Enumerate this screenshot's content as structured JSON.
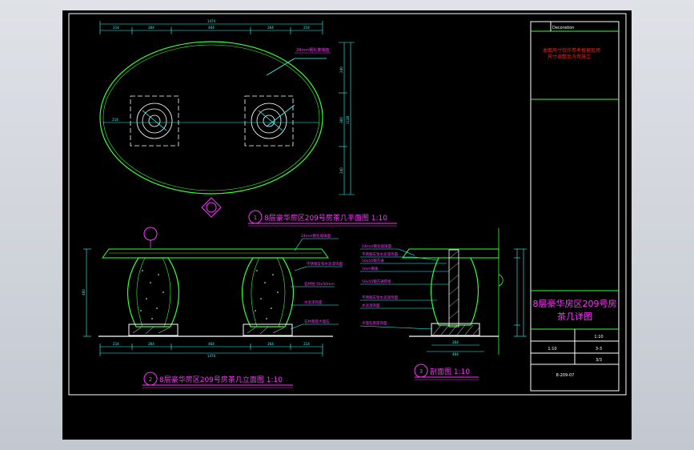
{
  "colors": {
    "background": "#000000",
    "frame": "#ffffff",
    "outline": "#33ff33",
    "dimension": "#33ffff",
    "label": "#ff33ff",
    "note": "#ff2222"
  },
  "plan": {
    "title": "8层豪华房区209号房茶几平面图 1:10",
    "badge": "1",
    "dims_top": [
      "1474",
      "214",
      "264",
      "464",
      "264",
      "214"
    ],
    "dims_right": [
      "240",
      "1128",
      "360",
      "240"
    ],
    "dim_left": "214",
    "callout": "24mm钢化玻璃面"
  },
  "elevation": {
    "title": "8层豪华房区209号房茶几立面图 1:10",
    "badge": "2",
    "dims_bottom": [
      "1474",
      "214",
      "264",
      "464",
      "264",
      "214"
    ],
    "dim_left": "460",
    "callouts": [
      "24mm钢化玻璃面",
      "不锈钢支架水泥漆饰面",
      "石材柱 50x50mm",
      "水泥漆饰面",
      "石材基座大理石"
    ]
  },
  "section": {
    "title": "剖面图 1:10",
    "badge": "3",
    "dims_bottom": [
      "264",
      "464"
    ],
    "callouts": [
      "24mm钢化玻璃面",
      "不锈钢支架水泥漆饰面",
      "50x50钢方通",
      "3mm钢板",
      "50x50钢方通焊接",
      "不锈钢支架水泥漆饰面",
      "水泥漆饰面",
      "大理石基座饰面"
    ]
  },
  "title_block": {
    "header": "Decoration",
    "note": "本图尺寸仅作参考根据现场\n尺寸调整后方可施工",
    "drawing_title_line1": "8层豪华房区209号房",
    "drawing_title_line2": "茶几详图",
    "scale_label": "1:10",
    "rows": [
      "1:10",
      "3-3",
      "3/3"
    ],
    "drawing_no": "8-209-07"
  }
}
